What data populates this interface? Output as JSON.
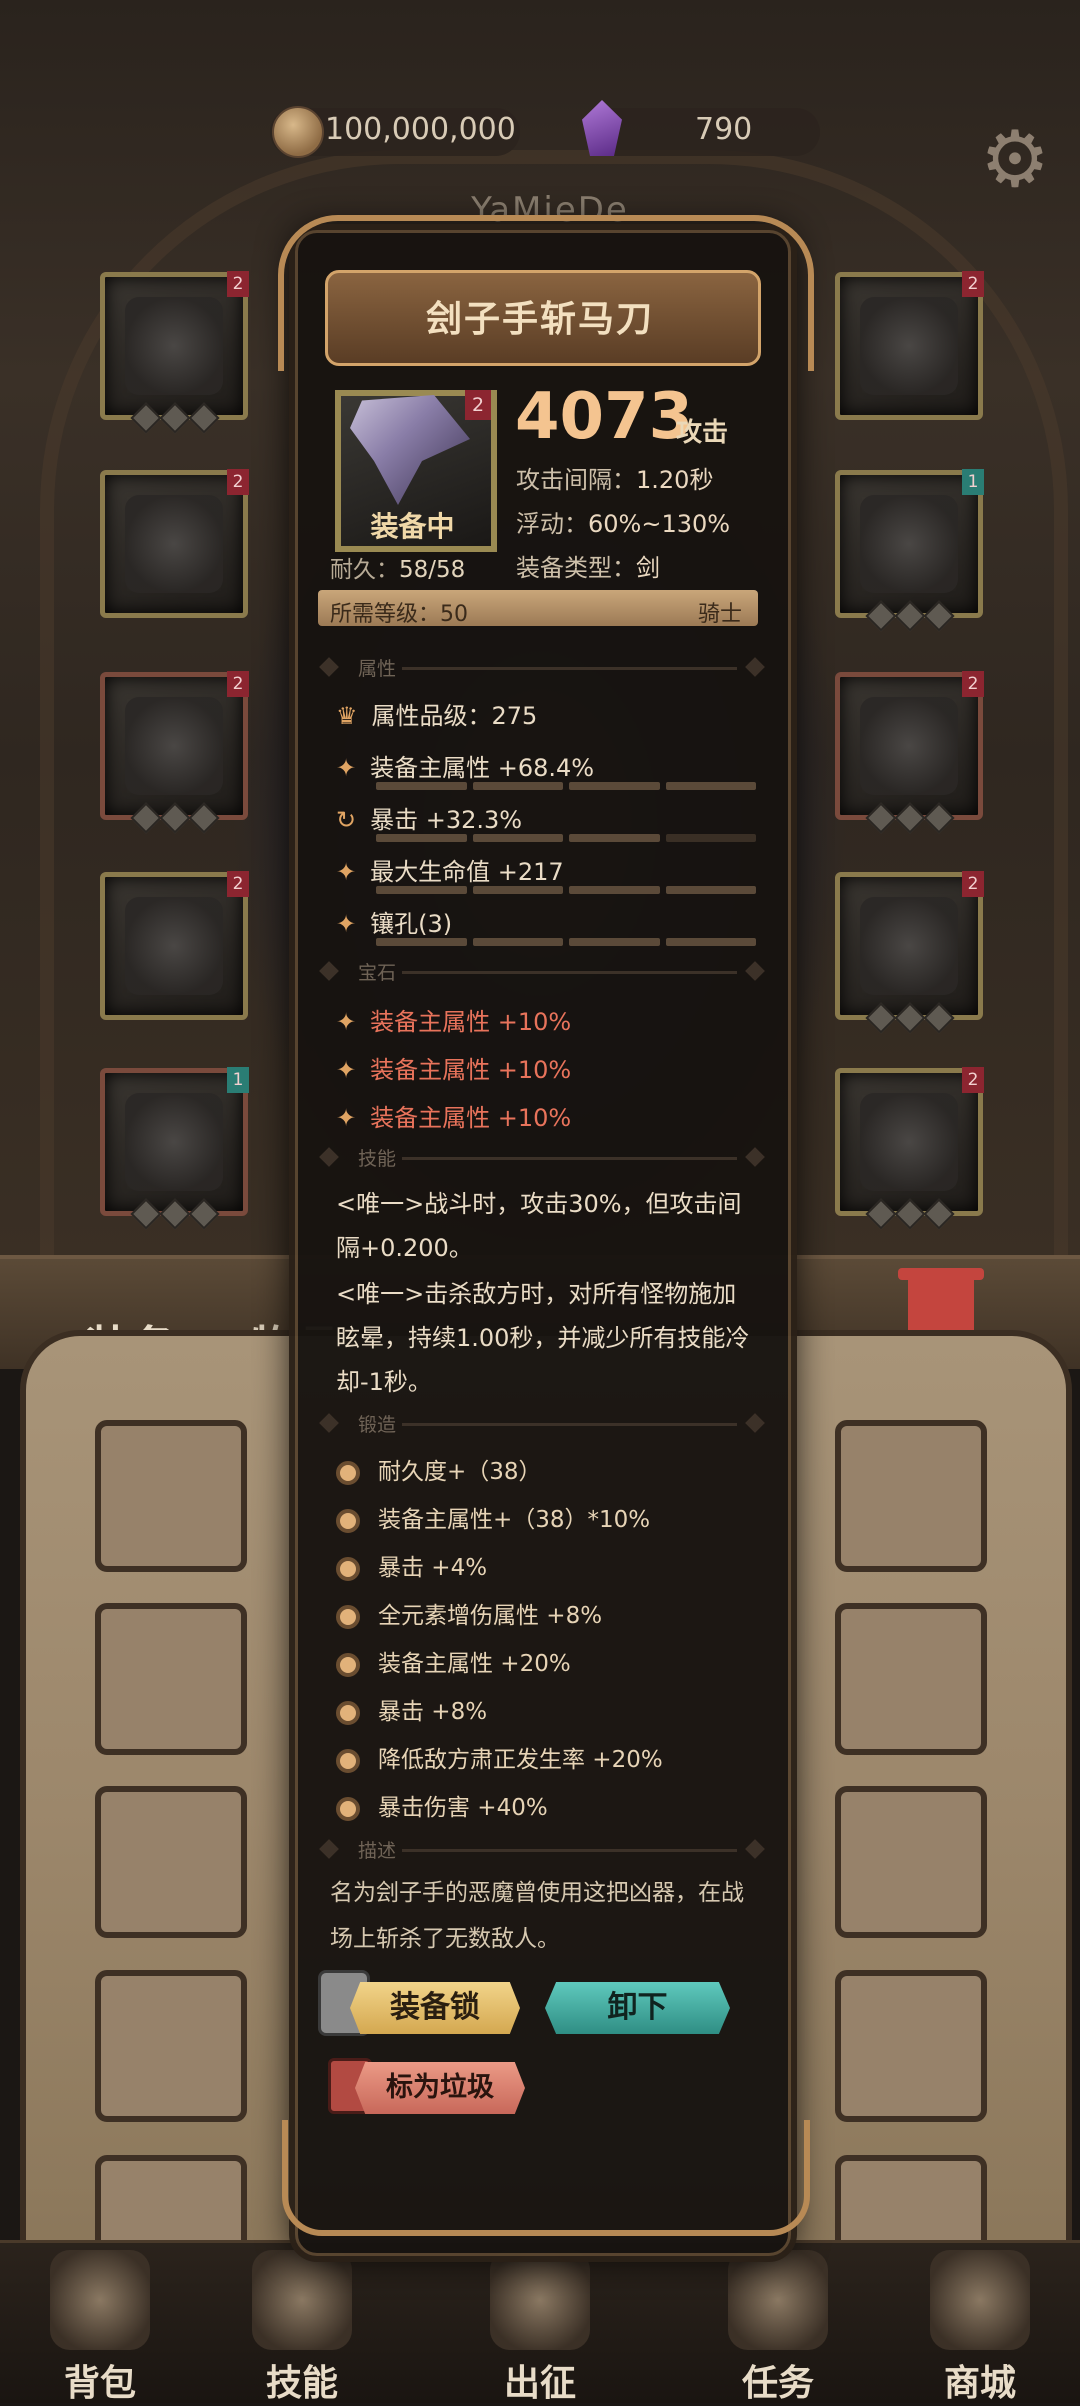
{
  "currency": {
    "gold": "100,000,000",
    "gems": "790"
  },
  "player_name": "YaMieDe",
  "tabs": {
    "equipment": "装备",
    "items": "物品"
  },
  "nav": [
    "背包",
    "技能",
    "出征",
    "任务",
    "商城"
  ],
  "item": {
    "name": "刽子手斩马刀",
    "level_badge": "2",
    "equipped": "装备中",
    "attack_value": "4073",
    "attack_unit": "攻击",
    "attack_interval_label": "攻击间隔：",
    "attack_interval": "1.20秒",
    "float_label": "浮动：",
    "float_value": "60%~130%",
    "type_label": "装备类型：",
    "type_value": "剑",
    "durability_label": "耐久：",
    "durability_value": "58/58",
    "req_level_label": "所需等级：",
    "req_level": "50",
    "req_class": "骑士"
  },
  "sections": {
    "attributes": "属性",
    "gems": "宝石",
    "skills": "技能",
    "forging": "锻造",
    "description": "描述"
  },
  "attributes": [
    {
      "text": "属性品级：275",
      "icon": "crown-icon"
    },
    {
      "text": "装备主属性 +68.4%",
      "icon": "star-icon"
    },
    {
      "text": "暴击 +32.3%",
      "icon": "reroll-icon"
    },
    {
      "text": "最大生命值 +217",
      "icon": "star-icon"
    },
    {
      "text": "镶孔(3)",
      "icon": "star-icon"
    }
  ],
  "gems": [
    "装备主属性 +10%",
    "装备主属性 +10%",
    "装备主属性 +10%"
  ],
  "skills": [
    "<唯一>战斗时，攻击30%，但攻击间隔+0.200。",
    "<唯一>击杀敌方时，对所有怪物施加眩晕，持续1.00秒，并减少所有技能冷却-1秒。"
  ],
  "forging": [
    "耐久度+（38）",
    "装备主属性+（38）*10%",
    "暴击 +4%",
    "全元素增伤属性 +8%",
    "装备主属性 +20%",
    "暴击 +8%",
    "降低敌方肃正发生率 +20%",
    "暴击伤害 +40%"
  ],
  "description": "名为刽子手的恶魔曾使用这把凶器，在战场上斩杀了无数敌人。",
  "buttons": {
    "lock": "装备锁",
    "unequip": "卸下",
    "junk": "标为垃圾"
  },
  "colors": {
    "accent_gold": "#f4c490",
    "gem_red": "#e8735b",
    "unequip_teal": "#2f8e84",
    "lock_yellow": "#d4a850",
    "junk_pink": "#c8685a"
  }
}
